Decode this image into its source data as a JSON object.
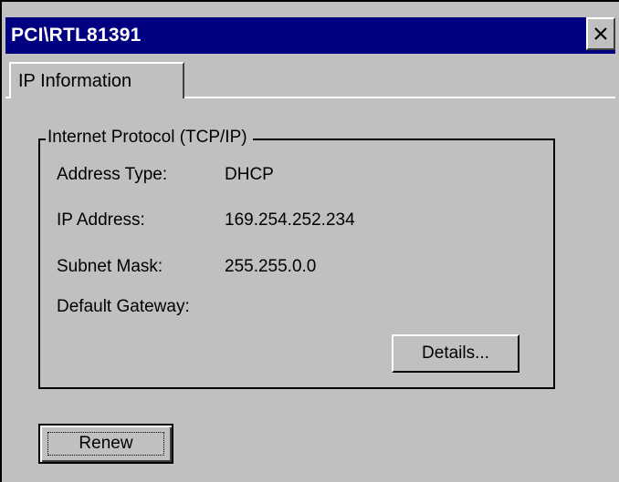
{
  "window": {
    "title": "PCI\\RTL81391",
    "close_icon": "close-icon"
  },
  "tabs": [
    {
      "label": "IP Information",
      "selected": true
    }
  ],
  "group": {
    "label": "Internet Protocol (TCP/IP)",
    "fields": [
      {
        "label": "Address Type:",
        "value": "DHCP"
      },
      {
        "label": "IP Address:",
        "value": "169.254.252.234"
      },
      {
        "label": "Subnet Mask:",
        "value": "255.255.0.0"
      },
      {
        "label": "Default Gateway:",
        "value": ""
      }
    ],
    "details_label": "Details..."
  },
  "renew_label": "Renew",
  "colors": {
    "titlebar": "#000080",
    "face": "#c0c0c0"
  }
}
